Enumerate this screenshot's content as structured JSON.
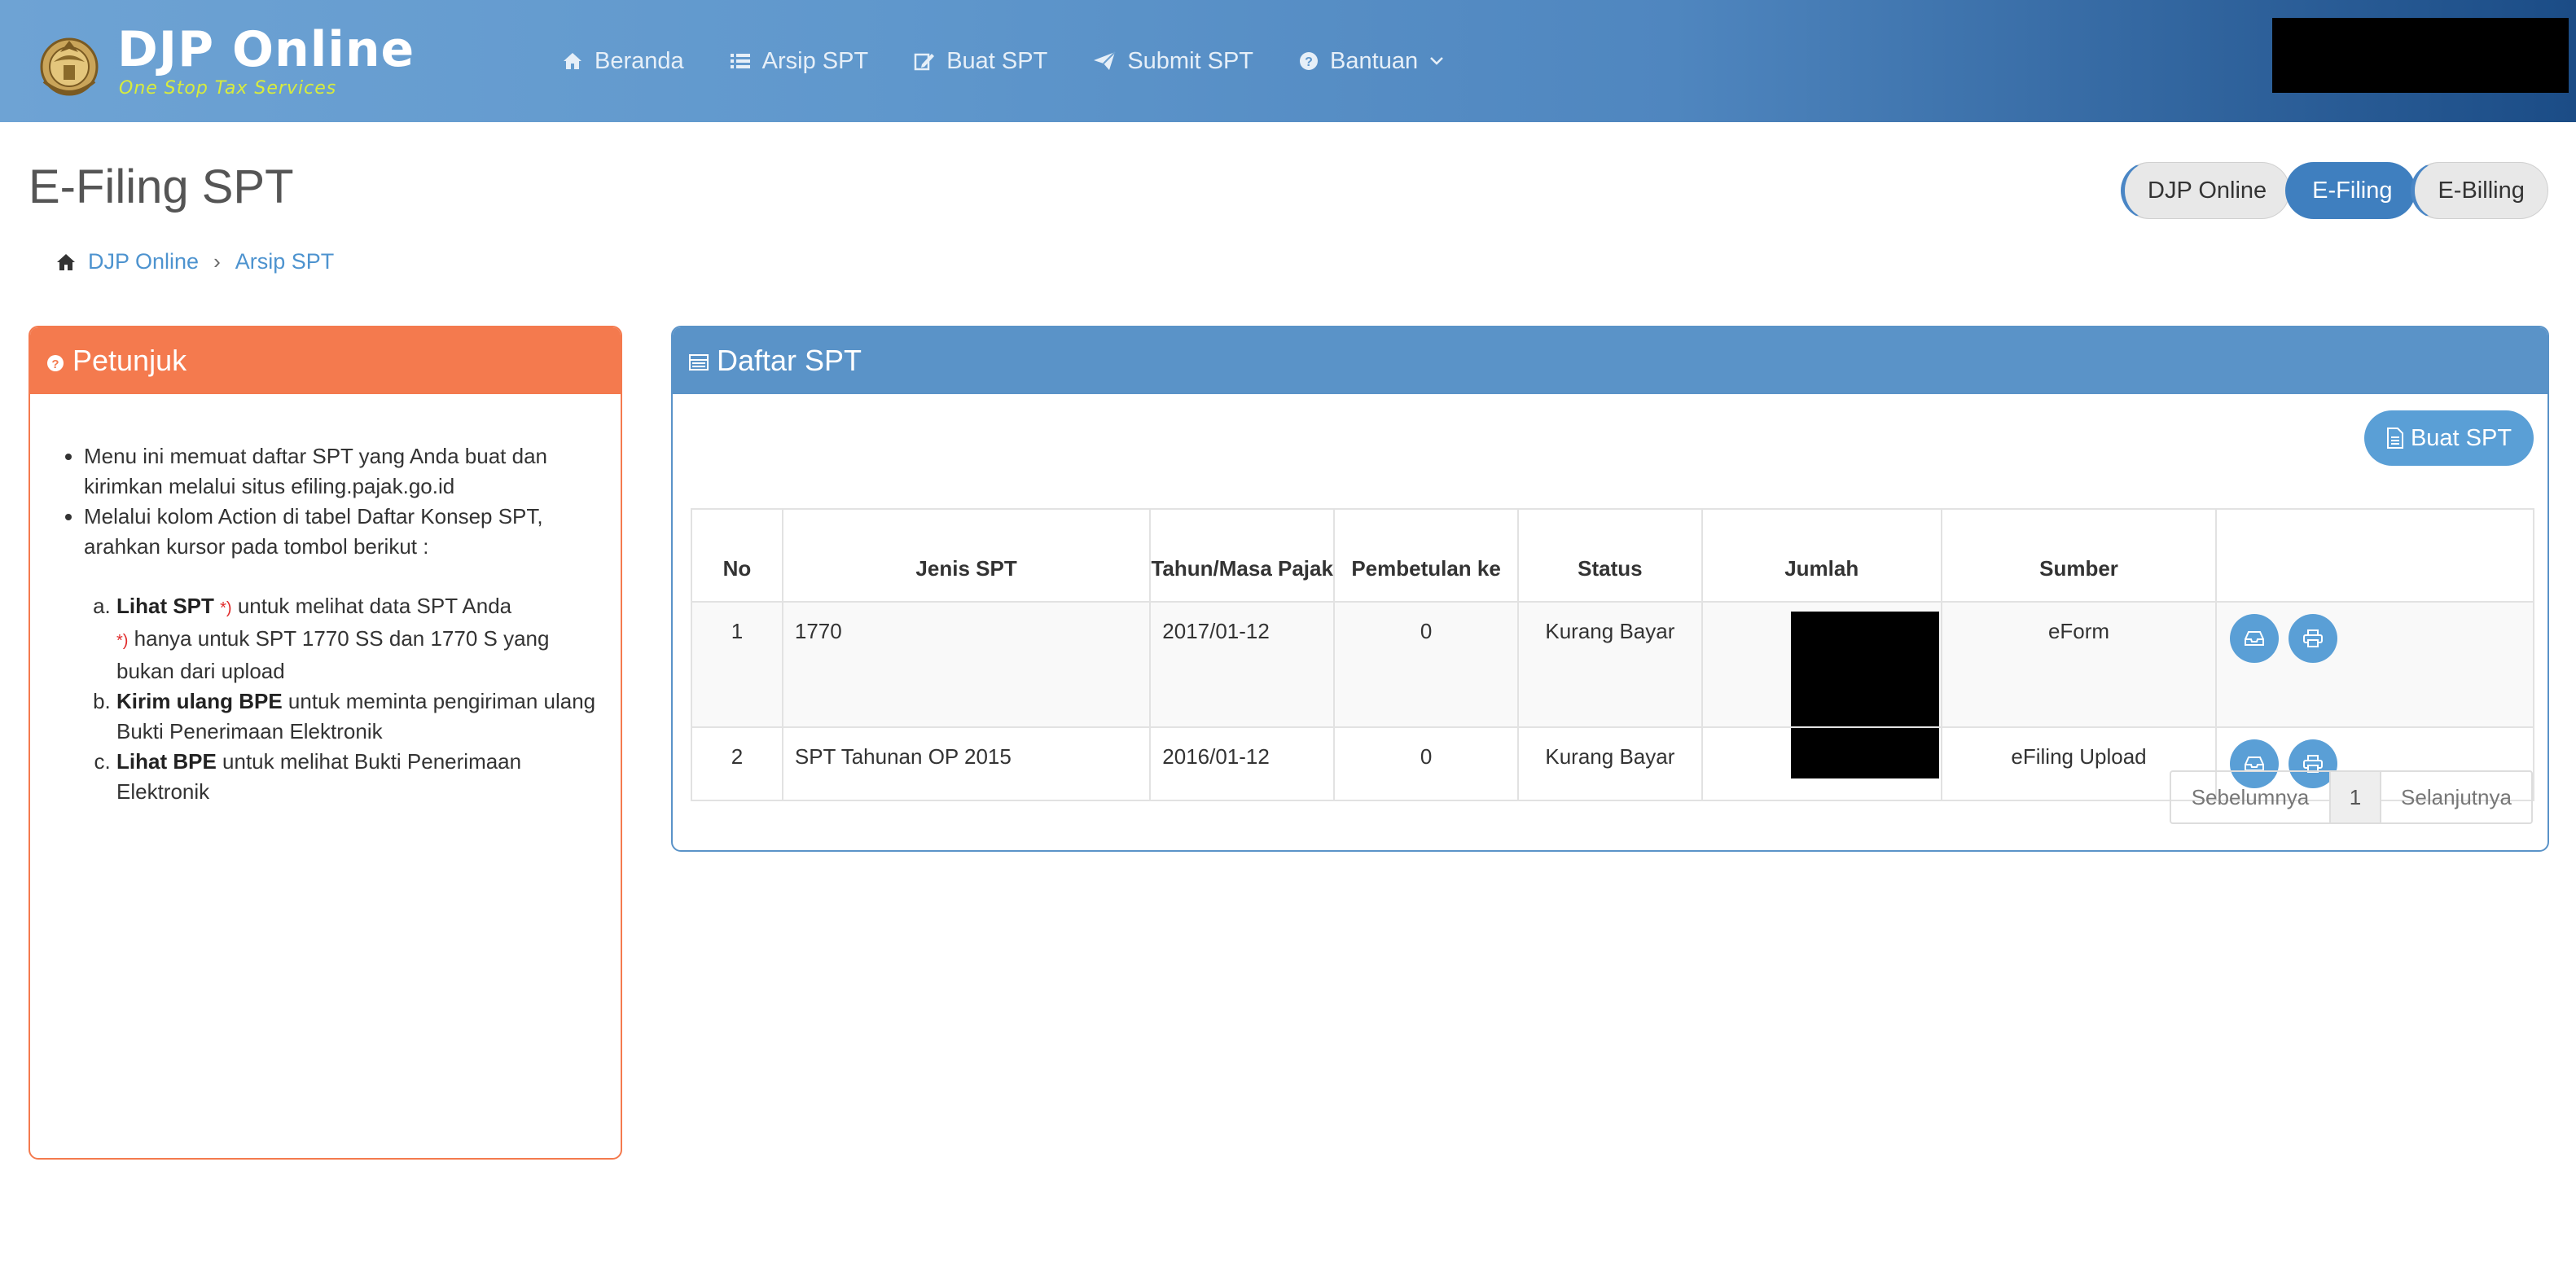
{
  "brand": {
    "title": "DJP Online",
    "subtitle": "One Stop Tax Services"
  },
  "nav": {
    "items": [
      {
        "label": "Beranda",
        "icon": "home-icon"
      },
      {
        "label": "Arsip SPT",
        "icon": "list-icon"
      },
      {
        "label": "Buat SPT",
        "icon": "edit-icon"
      },
      {
        "label": "Submit SPT",
        "icon": "paper-plane-icon"
      },
      {
        "label": "Bantuan",
        "icon": "question-circle-icon"
      }
    ]
  },
  "page": {
    "title": "E-Filing SPT"
  },
  "switcher": {
    "items": [
      "DJP Online",
      "E-Filing",
      "E-Billing"
    ],
    "active": "E-Filing"
  },
  "breadcrumb": {
    "home": "DJP Online",
    "current": "Arsip SPT"
  },
  "petunjuk": {
    "title": "Petunjuk",
    "bullets": [
      "Menu ini memuat daftar SPT yang Anda buat dan kirimkan melalui situs efiling.pajak.go.id",
      "Melalui kolom Action di tabel Daftar Konsep SPT, arahkan kursor pada tombol berikut :"
    ],
    "steps": [
      {
        "bold": "Lihat SPT",
        "note": "*)",
        "text": " untuk melihat data SPT Anda",
        "note2": "*)",
        "text2": " hanya untuk SPT 1770 SS dan 1770 S yang bukan dari upload"
      },
      {
        "bold": "Kirim ulang BPE",
        "text": " untuk meminta pengiriman ulang Bukti Penerimaan Elektronik"
      },
      {
        "bold": "Lihat BPE",
        "text": " untuk melihat Bukti Penerimaan Elektronik"
      }
    ]
  },
  "daftar": {
    "title": "Daftar SPT",
    "buat_label": "Buat SPT",
    "columns": [
      "No",
      "Jenis SPT",
      "Tahun/Masa Pajak",
      "Pembetulan ke",
      "Status",
      "Jumlah",
      "Sumber",
      ""
    ],
    "rows": [
      {
        "no": "1",
        "jenis": "1770",
        "tahun": "2017/01-12",
        "pembetulan": "0",
        "status": "Kurang Bayar",
        "jumlah": "",
        "sumber": "eForm"
      },
      {
        "no": "2",
        "jenis": "SPT Tahunan OP 2015",
        "tahun": "2016/01-12",
        "pembetulan": "0",
        "status": "Kurang Bayar",
        "jumlah": "",
        "sumber": "eFiling Upload"
      }
    ]
  },
  "pager": {
    "prev": "Sebelumnya",
    "page": "1",
    "next": "Selanjutnya"
  },
  "colors": {
    "header_start": "#6ea3d4",
    "header_end": "#1b4c86",
    "petunjuk": "#f47a4e",
    "daftar": "#5a93c8",
    "button": "#5a9fd6",
    "link": "#4d93cf"
  }
}
